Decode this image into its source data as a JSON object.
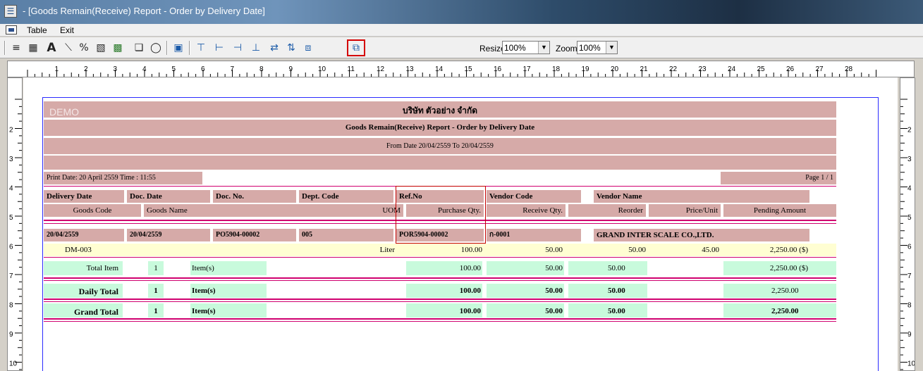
{
  "window": {
    "title": " - [Goods Remain(Receive) Report - Order by Delivery Date]"
  },
  "menu": {
    "items": [
      "Table",
      "Exit"
    ]
  },
  "toolbar": {
    "resize_label": "Resize:",
    "resize_value": "100%",
    "zoom_label": "Zoom:",
    "zoom_value": "100%"
  },
  "ruler": {
    "h_labels": [
      "1",
      "2",
      "3",
      "4",
      "5",
      "6",
      "7",
      "8",
      "9",
      "10",
      "11",
      "12",
      "13",
      "14",
      "15",
      "16",
      "17",
      "18",
      "19",
      "20",
      "21",
      "22",
      "23",
      "24",
      "25",
      "26",
      "27",
      "28"
    ],
    "v_labels": [
      "2",
      "3",
      "4",
      "5",
      "6",
      "7",
      "8",
      "9",
      "10"
    ]
  },
  "report": {
    "watermark": "DEMO",
    "company": "บริษัท ตัวอย่าง จำกัด",
    "title": "Goods Remain(Receive) Report - Order by Delivery Date",
    "date_range": "From Date 20/04/2559 To 20/04/2559",
    "print_date": "Print Date: 20 April 2559  Time : 11:55",
    "page": "Page 1 / 1",
    "header1": {
      "delivery_date": "Delivery Date",
      "doc_date": "Doc. Date",
      "doc_no": "Doc. No.",
      "dept_code": "Dept. Code",
      "ref_no": "Ref.No",
      "vendor_code": "Vendor Code",
      "vendor_name": "Vendor Name"
    },
    "header2": {
      "goods_code": "Goods Code",
      "goods_name": "Goods Name",
      "uom": "UOM",
      "purchase_qty": "Purchase Qty.",
      "receive_qty": "Receive Qty.",
      "reorder": "Reorder",
      "price_unit": "Price/Unit",
      "pending_amount": "Pending Amount"
    },
    "doc_row": {
      "delivery_date": "20/04/2559",
      "doc_date": "20/04/2559",
      "doc_no": "PO5904-00002",
      "dept_code": "005",
      "ref_no": "POR5904-00002",
      "vendor_code": "ก-0001",
      "vendor_name": "GRAND INTER SCALE CO.,LTD."
    },
    "item_row": {
      "goods_code": "DM-003",
      "uom": "Liter",
      "purchase_qty": "100.00",
      "receive_qty": "50.00",
      "reorder": "50.00",
      "price_unit": "45.00",
      "pending_amount": "2,250.00 ($)"
    },
    "total_item": {
      "label": "Total Item",
      "count": "1",
      "unit": "Item(s)",
      "purchase_qty": "100.00",
      "receive_qty": "50.00",
      "reorder": "50.00",
      "pending_amount": "2,250.00 ($)"
    },
    "daily_total": {
      "label": "Daily Total",
      "count": "1",
      "unit": "Item(s)",
      "purchase_qty": "100.00",
      "receive_qty": "50.00",
      "reorder": "50.00",
      "pending_amount": "2,250.00"
    },
    "grand_total": {
      "label": "Grand Total",
      "count": "1",
      "unit": "Item(s)",
      "purchase_qty": "100.00",
      "receive_qty": "50.00",
      "reorder": "50.00",
      "pending_amount": "2,250.00"
    }
  }
}
